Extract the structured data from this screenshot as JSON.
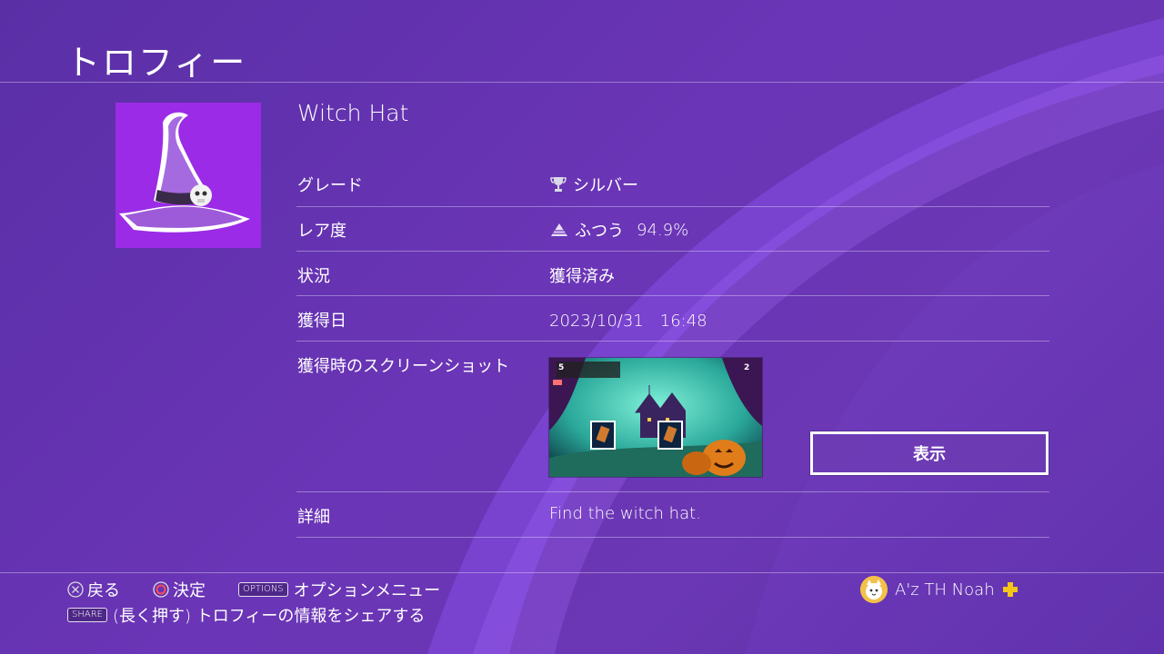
{
  "header": {
    "title": "トロフィー"
  },
  "trophy": {
    "name": "Witch Hat",
    "rows": {
      "grade": {
        "label": "グレード",
        "value": "シルバー"
      },
      "rarity": {
        "label": "レア度",
        "value": "ふつう",
        "percent": "94.9%"
      },
      "status": {
        "label": "状況",
        "value": "獲得済み"
      },
      "date": {
        "label": "獲得日",
        "value": "2023/10/31　16:48"
      },
      "screenshot": {
        "label": "獲得時のスクリーンショット",
        "view_button": "表示",
        "hud_left": "5",
        "hud_right": "2"
      },
      "detail": {
        "label": "詳細",
        "value": "Find the witch hat."
      }
    }
  },
  "footer": {
    "back_label": "戻る",
    "confirm_label": "決定",
    "options_tag": "OPTIONS",
    "options_label": "オプションメニュー",
    "share_tag": "SHARE",
    "share_label": "(長く押す) トロフィーの情報をシェアする"
  },
  "user": {
    "name": "A'z TH Noah"
  },
  "colors": {
    "background": "#6a35b6",
    "icon_bg": "#9b2be6",
    "plus": "#f5c518"
  }
}
